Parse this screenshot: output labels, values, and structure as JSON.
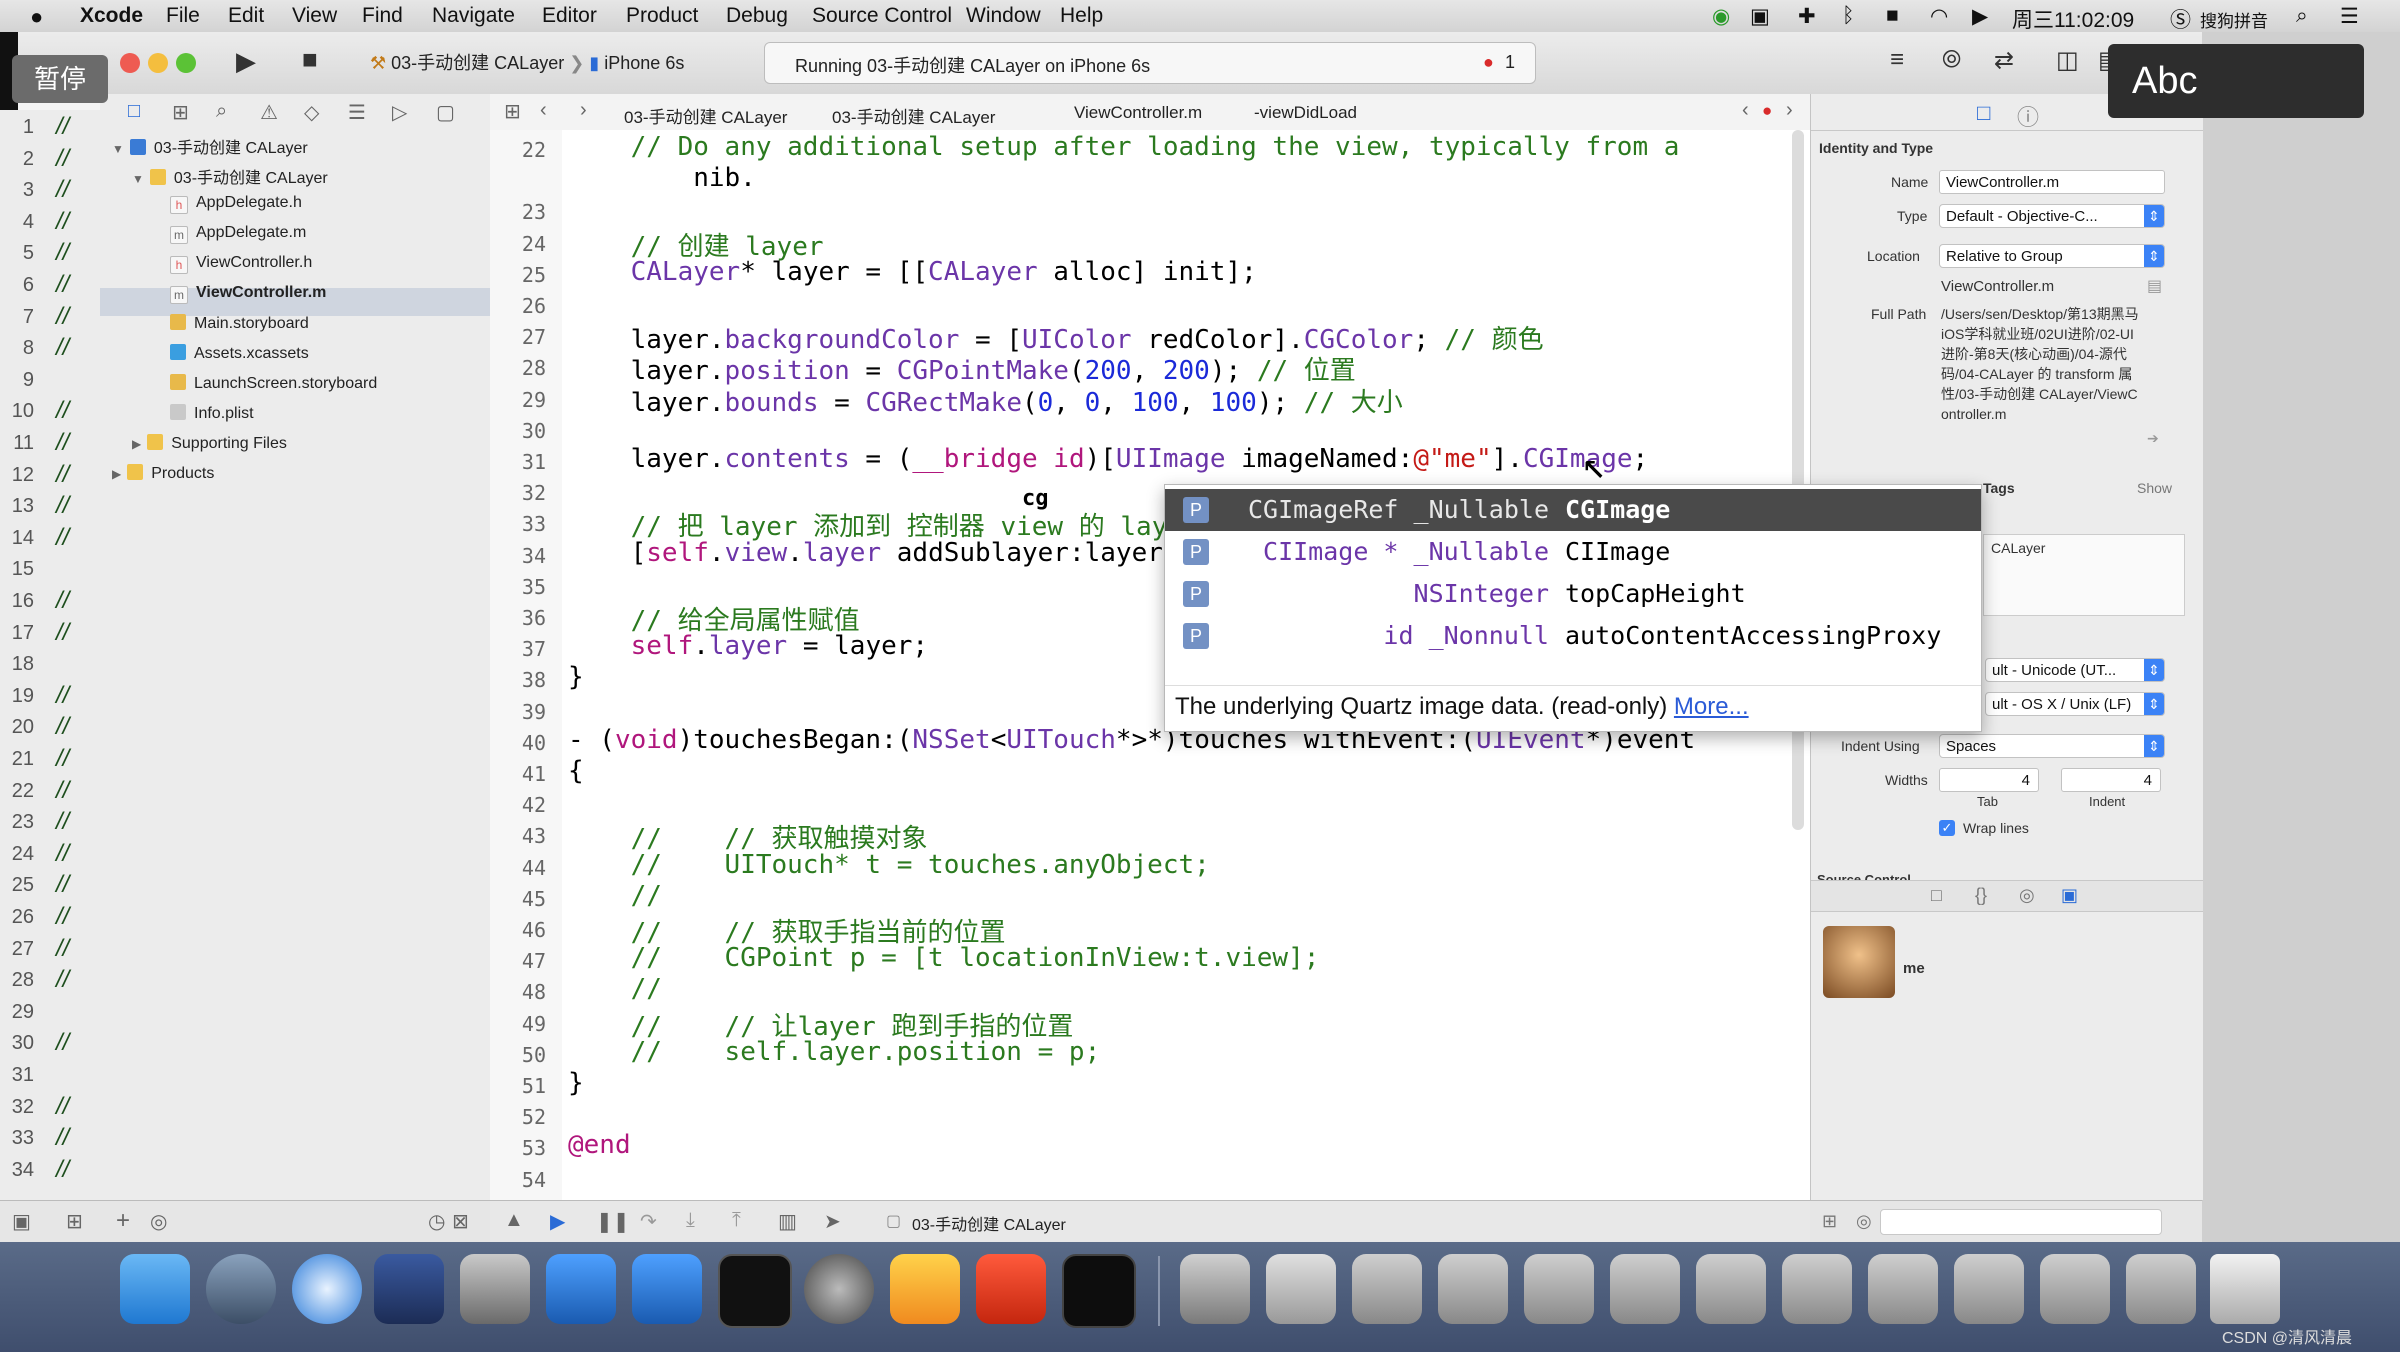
{
  "menubar": {
    "apple": "",
    "app_name": "Xcode",
    "items": [
      "File",
      "Edit",
      "View",
      "Find",
      "Navigate",
      "Editor",
      "Product",
      "Debug",
      "Source Control",
      "Window",
      "Help"
    ],
    "clock": "周三11:02:09",
    "input_method": "搜狗拼音"
  },
  "overlay": {
    "pause_label": "暂停",
    "ime_label": "Abc"
  },
  "toolbar": {
    "scheme": "03-手动创建 CALayer",
    "device": "iPhone 6s",
    "activity": "Running 03-手动创建 CALayer on iPhone 6s",
    "error_count": "1"
  },
  "left_numbers": {
    "lines": [
      "1",
      "2",
      "3",
      "4",
      "5",
      "6",
      "7",
      "8",
      "9",
      "10",
      "11",
      "12",
      "13",
      "14",
      "15",
      "16",
      "17",
      "18",
      "19",
      "20",
      "21",
      "22",
      "23",
      "24",
      "25",
      "26",
      "27",
      "28",
      "29",
      "30",
      "31",
      "32",
      "33",
      "34"
    ],
    "marks": [
      "//",
      "//",
      "//",
      "//",
      "//",
      "//",
      "//",
      "//",
      "",
      "//",
      "//",
      "//",
      "//",
      "//",
      "",
      "//",
      "//",
      "",
      "//",
      "//",
      "//",
      "//",
      "//",
      "//",
      "//",
      "//",
      "//",
      "//",
      "",
      "//",
      "",
      "//",
      "//",
      "//"
    ]
  },
  "navigator": {
    "items": [
      {
        "label": "03-手动创建 CALayer",
        "indent": 0,
        "icon": "project-icon",
        "disclosure": "▼"
      },
      {
        "label": "03-手动创建 CALayer",
        "indent": 1,
        "icon": "folder-icon",
        "disclosure": "▼"
      },
      {
        "label": "AppDelegate.h",
        "indent": 2,
        "icon": "h-file-icon",
        "disclosure": ""
      },
      {
        "label": "AppDelegate.m",
        "indent": 2,
        "icon": "m-file-icon",
        "disclosure": ""
      },
      {
        "label": "ViewController.h",
        "indent": 2,
        "icon": "h-file-icon",
        "disclosure": ""
      },
      {
        "label": "ViewController.m",
        "indent": 2,
        "icon": "m-file-icon",
        "disclosure": ""
      },
      {
        "label": "Main.storyboard",
        "indent": 2,
        "icon": "storyboard-icon",
        "disclosure": ""
      },
      {
        "label": "Assets.xcassets",
        "indent": 2,
        "icon": "assets-icon",
        "disclosure": ""
      },
      {
        "label": "LaunchScreen.storyboard",
        "indent": 2,
        "icon": "storyboard-icon",
        "disclosure": ""
      },
      {
        "label": "Info.plist",
        "indent": 2,
        "icon": "plist-icon",
        "disclosure": ""
      },
      {
        "label": "Supporting Files",
        "indent": 1,
        "icon": "folder-icon",
        "disclosure": "▶"
      },
      {
        "label": "Products",
        "indent": 0,
        "icon": "folder-icon",
        "disclosure": "▶"
      }
    ],
    "selected_index": 5
  },
  "jumpbar": {
    "crumbs": [
      "03-手动创建 CALayer",
      "03-手动创建 CALayer",
      "ViewController.m",
      "-viewDidLoad"
    ]
  },
  "editor": {
    "gutter": [
      "22",
      "",
      "23",
      "24",
      "25",
      "26",
      "27",
      "28",
      "29",
      "30",
      "31",
      "32",
      "33",
      "34",
      "35",
      "36",
      "37",
      "38",
      "39",
      "40",
      "41",
      "42",
      "43",
      "44",
      "45",
      "46",
      "47",
      "48",
      "49",
      "50",
      "51",
      "52",
      "53",
      "54"
    ],
    "lines": [
      "    // Do any additional setup after loading the view, typically from a",
      "        nib.",
      "",
      "    // 创建 layer",
      "    CALayer* layer = [[CALayer alloc] init];",
      "",
      "    layer.backgroundColor = [UIColor redColor].CGColor; // 颜色",
      "    layer.position = CGPointMake(200, 200); // 位置",
      "    layer.bounds = CGRectMake(0, 0, 100, 100); // 大小",
      "",
      "    layer.contents = (__bridge id)[UIImage imageNamed:@\"me\"].CGImage;",
      "",
      "    // 把 layer 添加到 控制器 view 的 layer",
      "    [self.view.layer addSublayer:layer];",
      "",
      "    // 给全局属性赋值",
      "    self.layer = layer;",
      "}",
      "",
      "- (void)touchesBegan:(NSSet<UITouch*>*)touches withEvent:(UIEvent*)event",
      "{",
      "",
      "    //    // 获取触摸对象",
      "    //    UITouch* t = touches.anyObject;",
      "    //",
      "    //    // 获取手指当前的位置",
      "    //    CGPoint p = [t locationInView:t.view];",
      "    //",
      "    //    // 让layer 跑到手指的位置",
      "    //    self.layer.position = p;",
      "}",
      "",
      "@end",
      ""
    ],
    "typed_fragment": "cg"
  },
  "autocomplete": {
    "rows": [
      {
        "kind": "P",
        "type": "CGImageRef _Nullable",
        "name": "CGImage"
      },
      {
        "kind": "P",
        "type": "CIImage * _Nullable",
        "name": "CIImage"
      },
      {
        "kind": "P",
        "type": "NSInteger",
        "name": "topCapHeight"
      },
      {
        "kind": "P",
        "type": "id _Nonnull",
        "name": "autoContentAccessingProxy"
      }
    ],
    "selected_index": 0,
    "description": "The underlying Quartz image data. (read-only)",
    "more_link": "More..."
  },
  "debugbar": {
    "target": "03-手动创建 CALayer"
  },
  "inspector": {
    "section_identity": "Identity and Type",
    "name_label": "Name",
    "name_value": "ViewController.m",
    "type_label": "Type",
    "type_value": "Default - Objective-C...",
    "location_label": "Location",
    "location_value": "Relative to Group",
    "location_file": "ViewController.m",
    "fullpath_label": "Full Path",
    "fullpath_value": "/Users/sen/Desktop/第13期黑马iOS学科就业班/02UI进阶/02-UI进阶-第8天(核心动画)/04-源代码/04-CALayer 的 transform 属性/03-手动创建 CALayer/ViewController.m",
    "tags_label": "Tags",
    "show_label": "Show",
    "target_fragment": "CALayer",
    "encoding_value": "ult - Unicode (UT...",
    "line_endings_value": "ult - OS X / Unix (LF)",
    "indent_using_label": "Indent Using",
    "indent_using_value": "Spaces",
    "widths_label": "Widths",
    "tab_value": "4",
    "indent_value": "4",
    "tab_label": "Tab",
    "indent_label": "Indent",
    "wrap_lines_label": "Wrap lines",
    "source_control_label": "Source Control",
    "library_item_label": "me"
  },
  "watermark": "CSDN @清风清晨",
  "colors": {
    "accent": "#3b82f6",
    "selection": "#cfd5df",
    "ac_selected": "#4a4a4a",
    "comment": "#2b7a1f",
    "keyword": "#b0167c",
    "class": "#6b35a8",
    "number": "#1b2ad8"
  }
}
